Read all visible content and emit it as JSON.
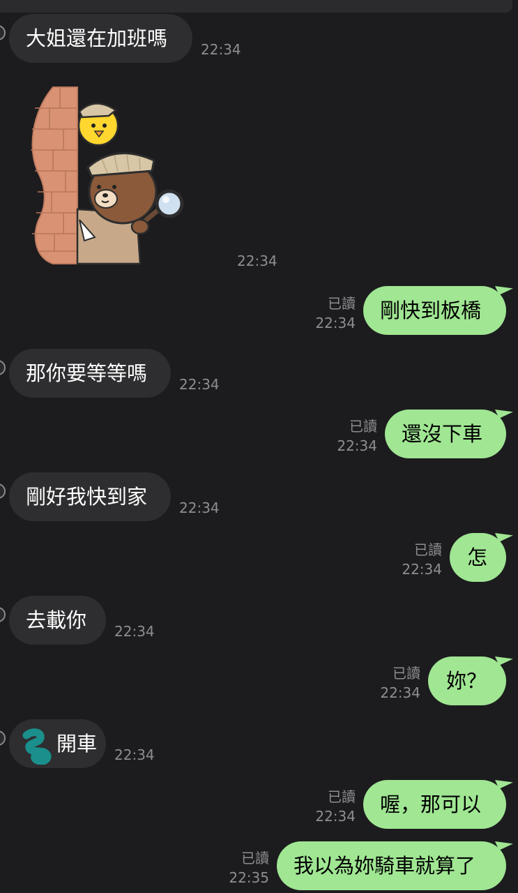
{
  "header": {
    "strip": ""
  },
  "messages": [
    {
      "dir": "in",
      "type": "text",
      "text": "大姐還在加班嗎",
      "time": "22:34"
    },
    {
      "dir": "in",
      "type": "sticker",
      "sticker": "detective-bear-sticker",
      "time": "22:34"
    },
    {
      "dir": "out",
      "type": "text",
      "text": "剛快到板橋",
      "read": "已讀",
      "time": "22:34"
    },
    {
      "dir": "in",
      "type": "text",
      "text": "那你要等等嗎",
      "time": "22:34"
    },
    {
      "dir": "out",
      "type": "text",
      "text": "還沒下車",
      "read": "已讀",
      "time": "22:34"
    },
    {
      "dir": "in",
      "type": "text",
      "text": "剛好我快到家",
      "time": "22:34"
    },
    {
      "dir": "out",
      "type": "text",
      "text": "怎",
      "read": "已讀",
      "time": "22:34"
    },
    {
      "dir": "in",
      "type": "text",
      "text": "去載你",
      "time": "22:34"
    },
    {
      "dir": "out",
      "type": "text",
      "text": "妳？",
      "read": "已讀",
      "time": "22:34"
    },
    {
      "dir": "in",
      "type": "text",
      "text": "開車",
      "time": "22:34",
      "redaction": "scribble-mark"
    },
    {
      "dir": "out",
      "type": "text",
      "text": "喔，那可以",
      "read": "已讀",
      "time": "22:34"
    },
    {
      "dir": "out",
      "type": "text",
      "text": "我以為妳騎車就算了",
      "read": "已讀",
      "time": "22:35"
    }
  ],
  "colors": {
    "background": "#1c1c1e",
    "incoming_bubble": "#2e2e30",
    "outgoing_bubble": "#a0e693",
    "meta_text": "#8e8e93",
    "redaction": "#1a8f8c"
  }
}
